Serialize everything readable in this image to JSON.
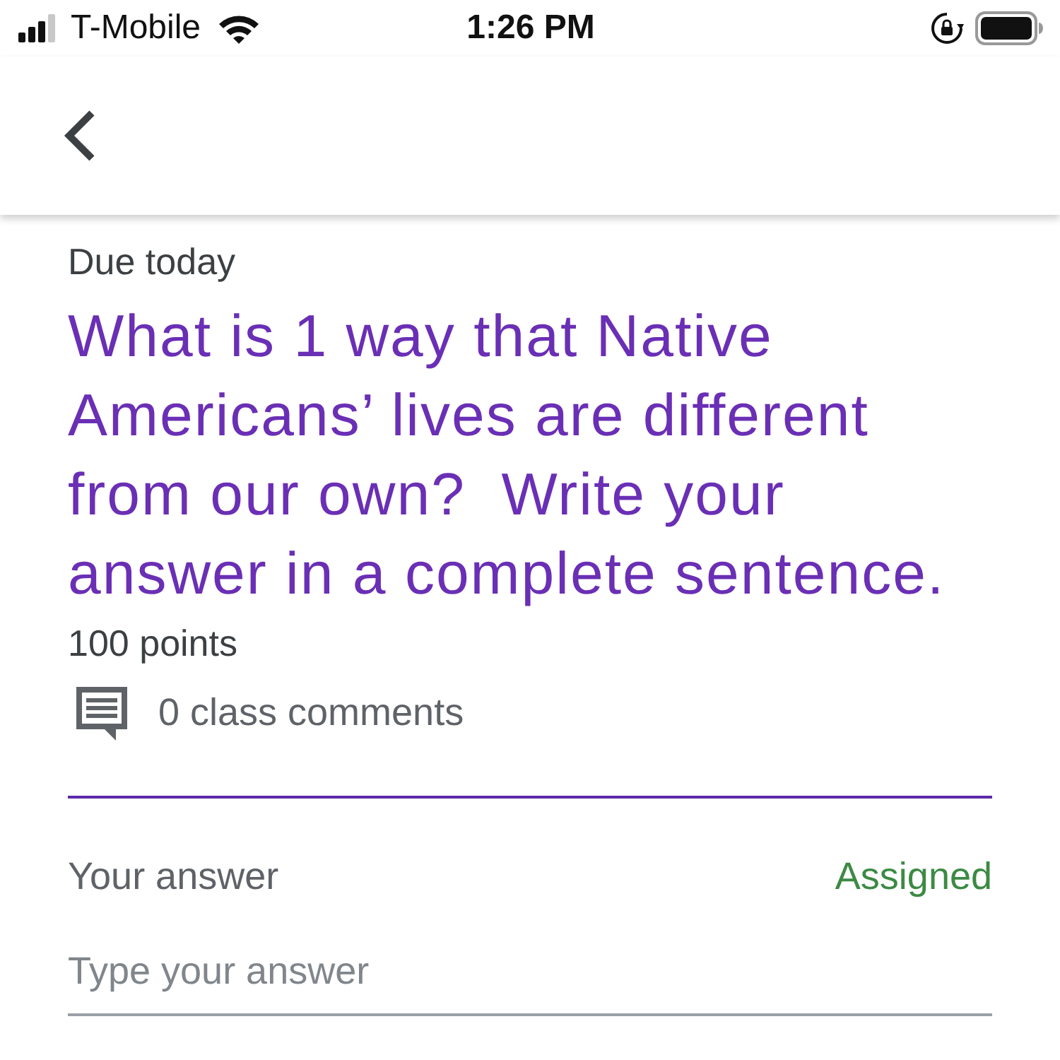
{
  "status_bar": {
    "carrier": "T-Mobile",
    "time": "1:26 PM"
  },
  "assignment": {
    "due": "Due today",
    "title": "What is 1 way that Native Americans’ lives are different from our own?  Write your answer in a complete sentence.",
    "points": "100 points",
    "comments": "0 class comments"
  },
  "answer": {
    "label": "Your answer",
    "status": "Assigned",
    "placeholder": "Type your answer"
  }
}
